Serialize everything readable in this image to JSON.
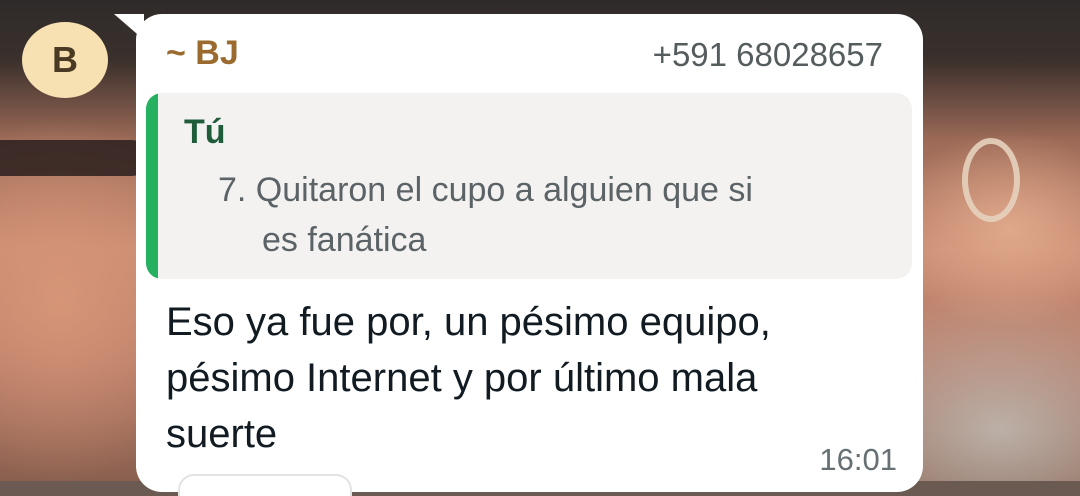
{
  "avatar": {
    "initial": "B",
    "color": "#f7e0b2"
  },
  "message": {
    "sender_name": "~ BJ",
    "sender_phone": "+591 68028657",
    "quoted": {
      "author": "Tú",
      "line1": "7. Quitaron el cupo a alguien que si",
      "line2": "es fanática"
    },
    "text_lines": [
      "Eso ya fue por, un pésimo equipo,",
      "pésimo Internet y por último mala",
      "suerte"
    ],
    "time": "16:01"
  },
  "colors": {
    "bubble": "#ffffff",
    "quote_bar": "#25b15f",
    "sender_name": "#9a6a2f",
    "quote_author": "#1e5c3a"
  }
}
